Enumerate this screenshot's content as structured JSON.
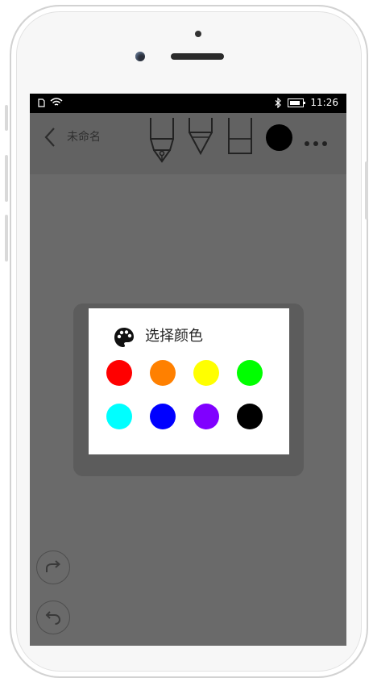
{
  "statusbar": {
    "time": "11:26"
  },
  "toolbar": {
    "title": "未命名",
    "tools": [
      "pen-nib-icon",
      "marker-icon",
      "eraser-icon"
    ],
    "current_color": "#000000"
  },
  "dialog": {
    "title": "选择颜色",
    "colors": [
      "#ff0000",
      "#ff8000",
      "#ffff00",
      "#00ff00",
      "#00ffff",
      "#0000ff",
      "#8000ff",
      "#000000"
    ]
  },
  "floating_buttons": [
    "redo-icon",
    "undo-icon"
  ]
}
